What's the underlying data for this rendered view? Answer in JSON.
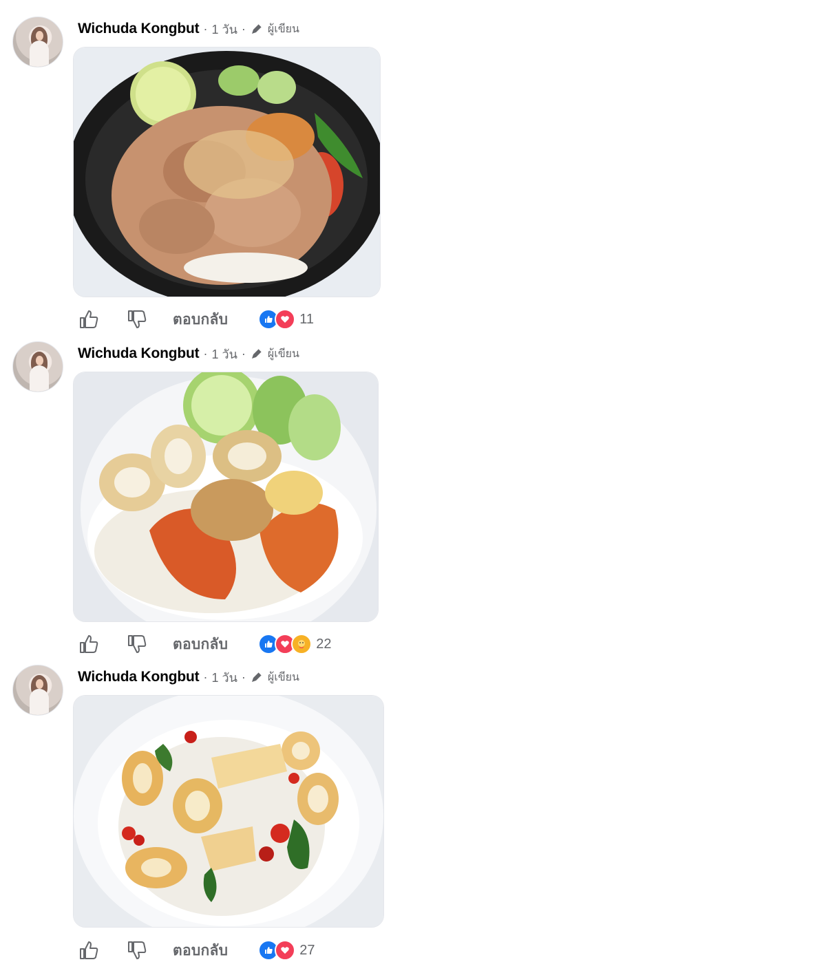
{
  "comments": [
    {
      "author": "Wichuda Kongbut",
      "time": "1 วัน",
      "role": "ผู้เขียน",
      "photo": "pork-rice-bowl",
      "reply_label": "ตอบกลับ",
      "reactions": [
        "like",
        "love"
      ],
      "reaction_count": "11"
    },
    {
      "author": "Wichuda Kongbut",
      "time": "1 วัน",
      "role": "ผู้เขียน",
      "photo": "seafood-rice-plate",
      "reply_label": "ตอบกลับ",
      "reactions": [
        "like",
        "love",
        "care"
      ],
      "reaction_count": "22"
    },
    {
      "author": "Wichuda Kongbut",
      "time": "1 วัน",
      "role": "ผู้เขียน",
      "photo": "squid-basil-plate",
      "reply_label": "ตอบกลับ",
      "reactions": [
        "like",
        "love"
      ],
      "reaction_count": "27"
    }
  ],
  "colors": {
    "like": "#1877f2",
    "love": "#f33e58",
    "care": "#f7b125",
    "secondary_text": "#65676b"
  }
}
